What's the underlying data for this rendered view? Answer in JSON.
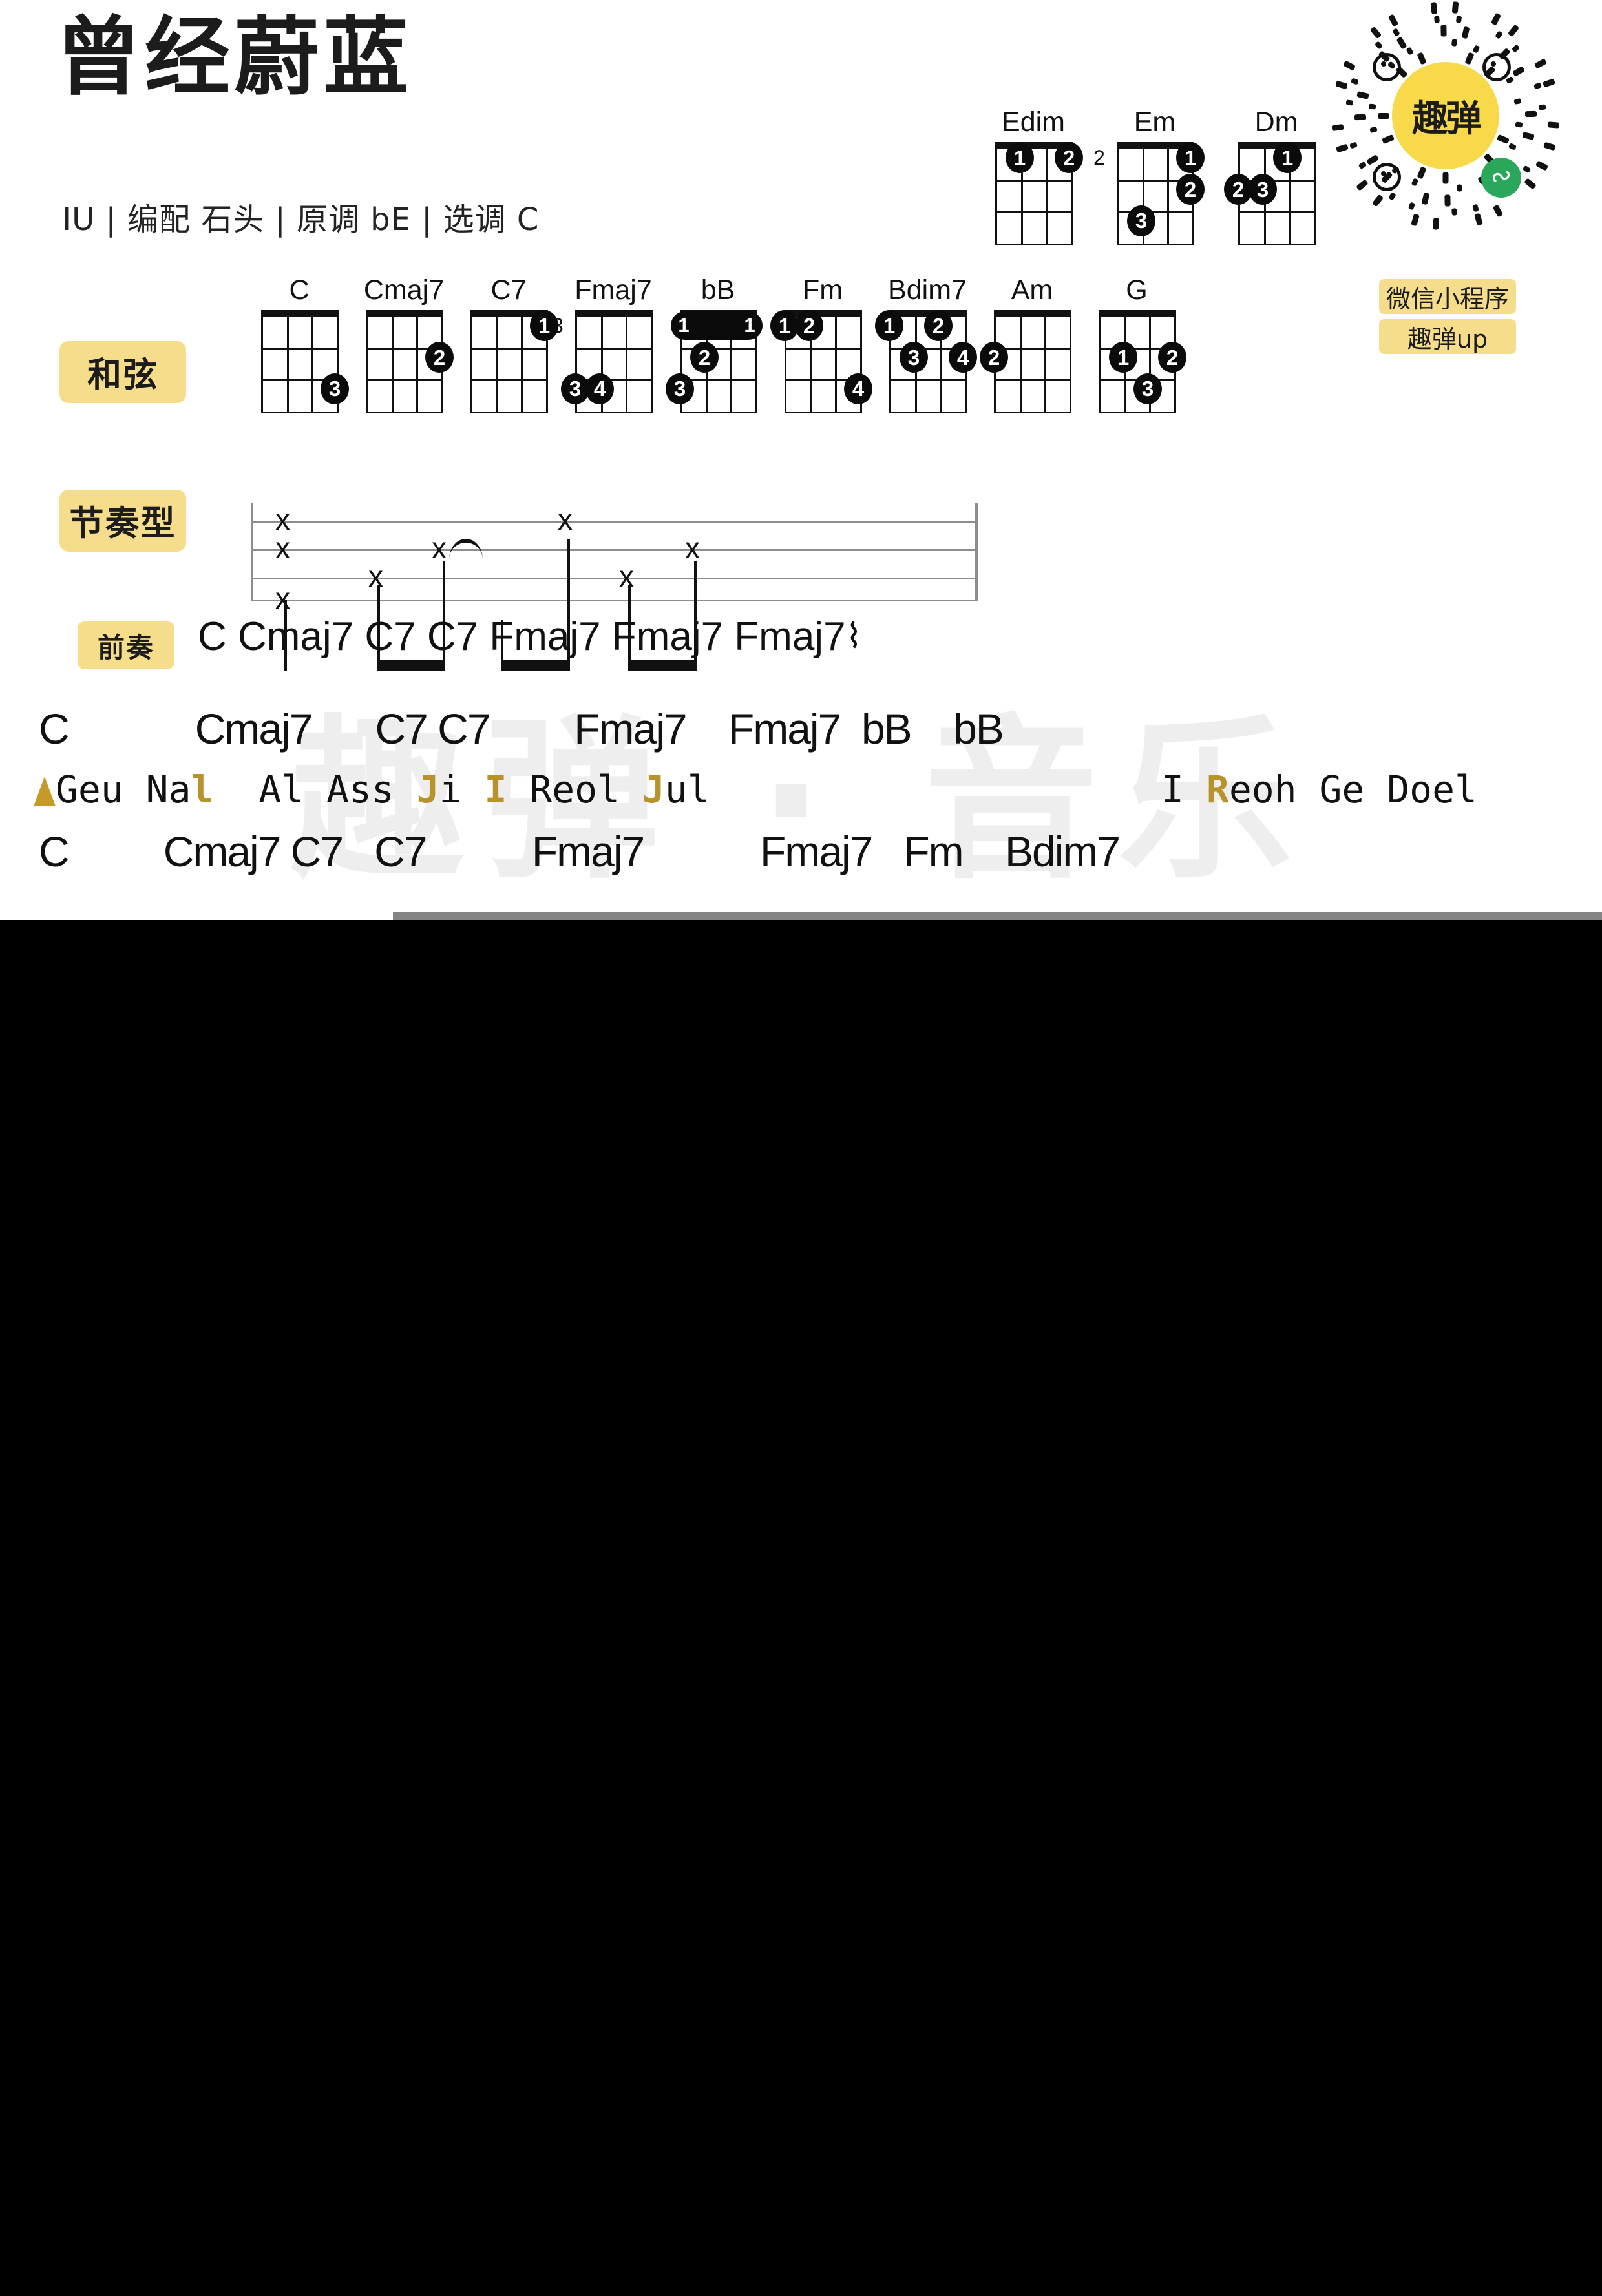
{
  "header": {
    "title": "曾经蔚蓝",
    "subtitle": "IU | 编配 石头 | 原调 bE | 选调 C"
  },
  "watermark": "趣弹 · 音乐",
  "labels": {
    "chords": "和弦",
    "rhythm": "节奏型",
    "intro": "前奏"
  },
  "badge": {
    "logo_text": "趣弹",
    "pill_1": "微信小程序",
    "pill_2": "趣弹up",
    "accent": "#f8d94a",
    "wechat_green": "#2aa75b"
  },
  "top_chords": [
    {
      "name": "Edim",
      "fret": "",
      "dots": [
        {
          "s": 2,
          "f": 1,
          "n": "1"
        },
        {
          "s": 4,
          "f": 1,
          "n": "2"
        }
      ],
      "nut": true
    },
    {
      "name": "Em",
      "fret": "2",
      "dots": [
        {
          "s": 4,
          "f": 1,
          "n": "1"
        },
        {
          "s": 4,
          "f": 2,
          "n": "2"
        },
        {
          "s": 2,
          "f": 3,
          "n": "3"
        }
      ],
      "nut": true
    },
    {
      "name": "Dm",
      "fret": "",
      "dots": [
        {
          "s": 3,
          "f": 1,
          "n": "1"
        },
        {
          "s": 1,
          "f": 2,
          "n": "2"
        },
        {
          "s": 2,
          "f": 2,
          "n": "3"
        }
      ],
      "nut": true
    }
  ],
  "chord_row": [
    {
      "name": "C",
      "fret": "",
      "nut": true,
      "dots": [
        {
          "s": 4,
          "f": 3,
          "n": "3"
        }
      ]
    },
    {
      "name": "Cmaj7",
      "fret": "",
      "nut": true,
      "dots": [
        {
          "s": 4,
          "f": 2,
          "n": "2"
        }
      ]
    },
    {
      "name": "C7",
      "fret": "",
      "nut": true,
      "dots": [
        {
          "s": 4,
          "f": 1,
          "n": "1"
        }
      ]
    },
    {
      "name": "Fmaj7",
      "fret": "3",
      "nut": true,
      "dots": [
        {
          "s": 1,
          "f": 3,
          "n": "3"
        },
        {
          "s": 2,
          "f": 3,
          "n": "4"
        }
      ]
    },
    {
      "name": "bB",
      "fret": "",
      "nut": true,
      "barre": {
        "f": 1,
        "left": "1",
        "right": "1"
      },
      "dots": [
        {
          "s": 2,
          "f": 2,
          "n": "2"
        },
        {
          "s": 1,
          "f": 3,
          "n": "3"
        }
      ]
    },
    {
      "name": "Fm",
      "fret": "",
      "nut": true,
      "dots": [
        {
          "s": 1,
          "f": 1,
          "n": "1"
        },
        {
          "s": 2,
          "f": 1,
          "n": "2"
        },
        {
          "s": 4,
          "f": 3,
          "n": "4"
        }
      ]
    },
    {
      "name": "Bdim7",
      "fret": "",
      "nut": true,
      "dots": [
        {
          "s": 1,
          "f": 1,
          "n": "1"
        },
        {
          "s": 3,
          "f": 1,
          "n": "2"
        },
        {
          "s": 2,
          "f": 2,
          "n": "3"
        },
        {
          "s": 4,
          "f": 2,
          "n": "4"
        }
      ]
    },
    {
      "name": "Am",
      "fret": "",
      "nut": true,
      "dots": [
        {
          "s": 1,
          "f": 2,
          "n": "2"
        }
      ]
    },
    {
      "name": "G",
      "fret": "",
      "nut": true,
      "dots": [
        {
          "s": 2,
          "f": 2,
          "n": "1"
        },
        {
          "s": 4,
          "f": 2,
          "n": "2"
        },
        {
          "s": 3,
          "f": 3,
          "n": "3"
        }
      ]
    }
  ],
  "intro_chords": "C   Cmaj7   C7    C7    Fmaj7 Fmaj7 Fmaj7",
  "intro_arpeggio": "⌇",
  "rhythm_pattern": {
    "description": "x strokes on 4 ukulele strings with beams and a tie",
    "x_marks": [
      {
        "string": 1,
        "beat": 0
      },
      {
        "string": 2,
        "beat": 0
      },
      {
        "string": 4,
        "beat": 0
      },
      {
        "string": 3,
        "beat": 1
      },
      {
        "string": 2,
        "beat": 1.5
      },
      {
        "string": 1,
        "beat": 2.5
      },
      {
        "string": 3,
        "beat": 3
      },
      {
        "string": 2,
        "beat": 3.5
      }
    ]
  },
  "song_lines": [
    {
      "chords": "C            Cmaj7      C7 C7        Fmaj7    Fmaj7  bB    bB",
      "lyric_prefix_marker": "▲",
      "lyric_parts": [
        {
          "t": "Geu Na",
          "hl": false
        },
        {
          "t": "l",
          "hl": true
        },
        {
          "t": "  Al Ass ",
          "hl": false
        },
        {
          "t": "J",
          "hl": true
        },
        {
          "t": "i ",
          "hl": false
        },
        {
          "t": "I",
          "hl": true
        },
        {
          "t": " Reol ",
          "hl": false
        },
        {
          "t": "J",
          "hl": true
        },
        {
          "t": "ul                    I ",
          "hl": false
        },
        {
          "t": "R",
          "hl": true
        },
        {
          "t": "eoh Ge Doel",
          "hl": false
        }
      ]
    },
    {
      "chords": "C         Cmaj7 C7   C7          Fmaj7           Fmaj7   Fm    Bdim7",
      "lyric_prefix_marker": "",
      "lyric_parts": []
    }
  ]
}
